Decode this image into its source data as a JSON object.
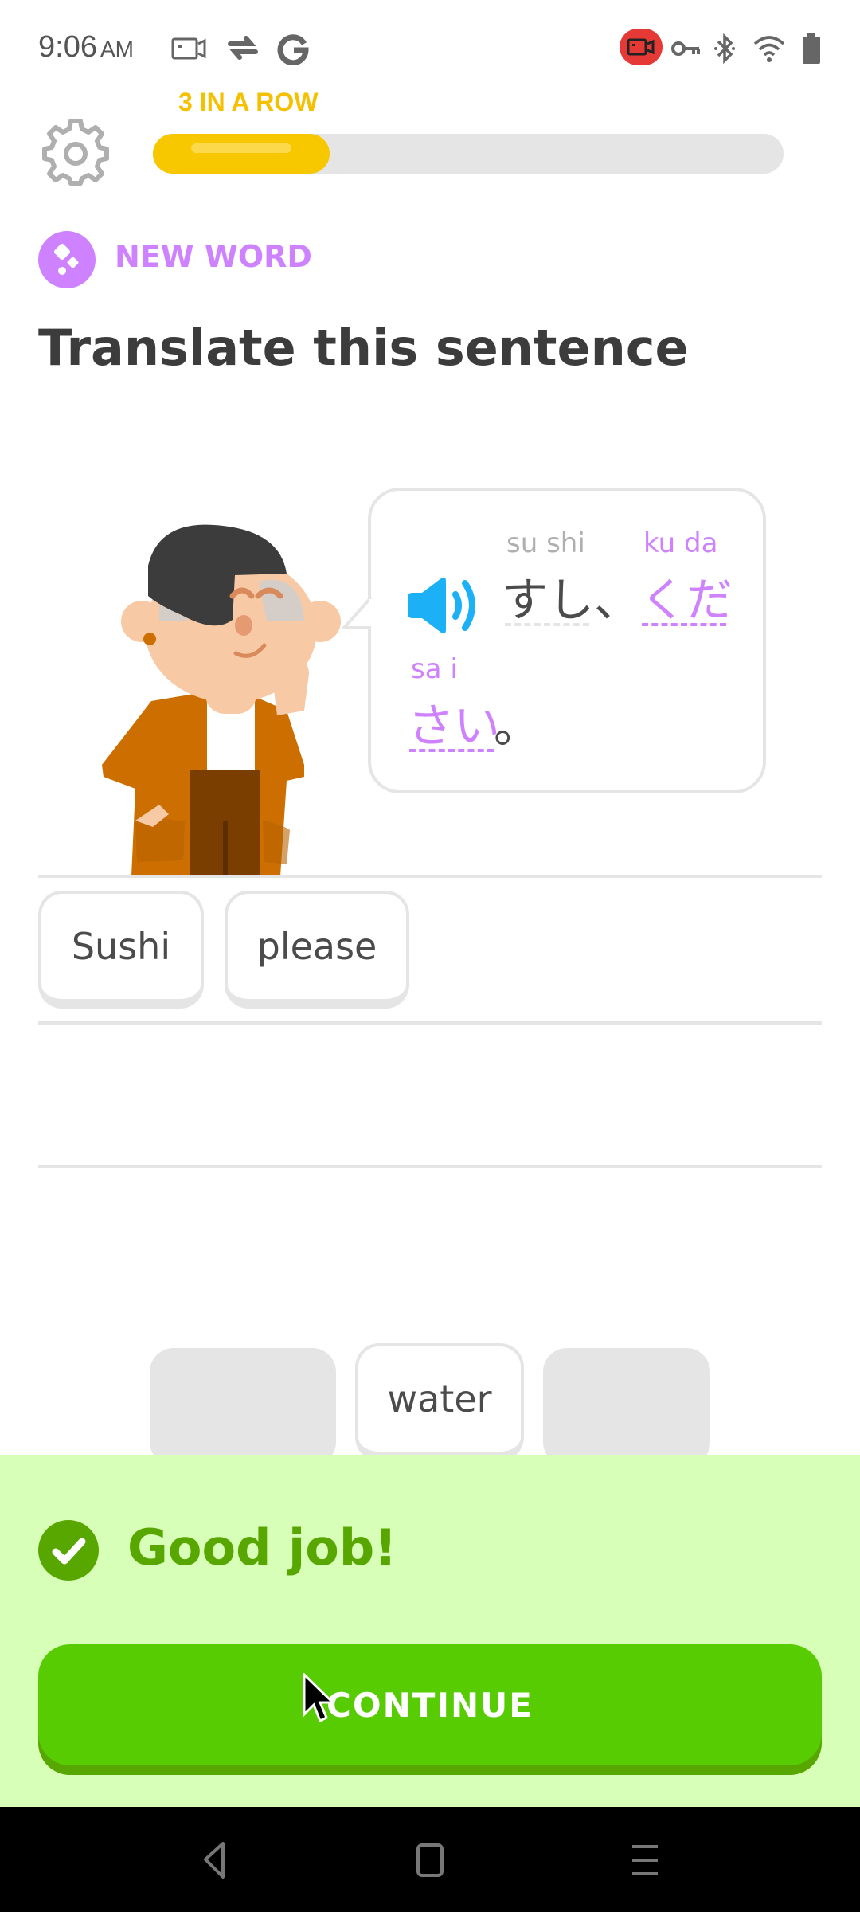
{
  "status_bar": {
    "time": "9:06",
    "ampm": "AM",
    "left_icons": [
      "screen-record-icon",
      "sync-check-icon",
      "google-icon"
    ],
    "right_icons": [
      "recording-indicator-icon",
      "vpn-key-icon",
      "bluetooth-icon",
      "wifi-icon",
      "battery-icon"
    ],
    "recording_color": "#e53935"
  },
  "header": {
    "streak_label": "3 IN A ROW",
    "progress_fraction": 0.28,
    "progress_color": "#f7c800"
  },
  "lesson": {
    "badge_label": "NEW WORD",
    "badge_color": "#ce82ff",
    "title": "Translate this sentence"
  },
  "bubble": {
    "segments": [
      {
        "furigana": "su shi",
        "text": "すし、",
        "color": "#4b4b4b",
        "new": false
      },
      {
        "furigana": "ku da",
        "text": "くだ",
        "color": "#ce82ff",
        "new": true
      },
      {
        "furigana": "sa  i",
        "text": "さい",
        "color": "#ce82ff",
        "new": true
      },
      {
        "furigana": "",
        "text": "。",
        "color": "#4b4b4b",
        "new": false
      }
    ],
    "speaker_color": "#1cb0f6"
  },
  "answer": {
    "chips": [
      "Sushi",
      "please"
    ]
  },
  "word_bank": {
    "chips": [
      {
        "label": "",
        "used": true
      },
      {
        "label": "water",
        "used": false
      },
      {
        "label": "",
        "used": true
      }
    ]
  },
  "feedback": {
    "message": "Good job!",
    "button_label": "CONTINUE",
    "accent": "#58cc02"
  },
  "nav_bar": {
    "buttons": [
      "back",
      "home",
      "recents"
    ]
  }
}
